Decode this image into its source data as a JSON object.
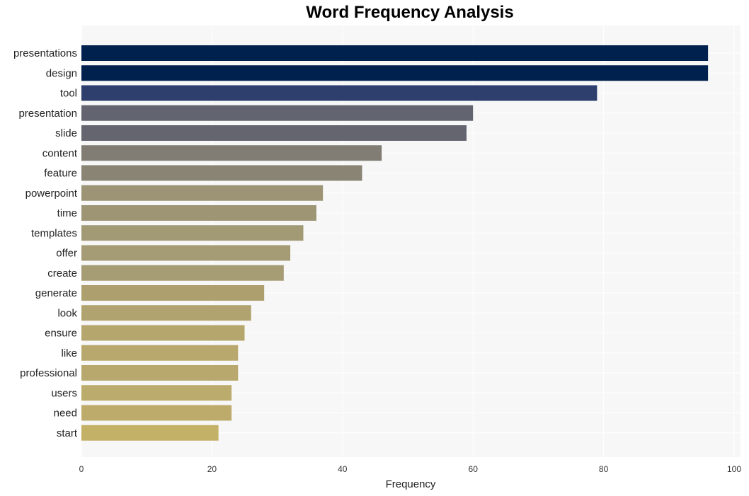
{
  "chart_data": {
    "type": "bar",
    "orientation": "horizontal",
    "title": "Word Frequency Analysis",
    "xlabel": "Frequency",
    "ylabel": "",
    "xlim": [
      0,
      100
    ],
    "xticks": [
      0,
      20,
      40,
      60,
      80,
      100
    ],
    "grid": true,
    "categories": [
      "presentations",
      "design",
      "tool",
      "presentation",
      "slide",
      "content",
      "feature",
      "powerpoint",
      "time",
      "templates",
      "offer",
      "create",
      "generate",
      "look",
      "ensure",
      "like",
      "professional",
      "users",
      "need",
      "start"
    ],
    "values": [
      96,
      96,
      79,
      60,
      59,
      46,
      43,
      37,
      36,
      34,
      32,
      31,
      28,
      26,
      25,
      24,
      24,
      23,
      23,
      21
    ],
    "colors": [
      "#00214e",
      "#00214e",
      "#2e3f6e",
      "#626570",
      "#64656f",
      "#817d74",
      "#898473",
      "#9c9474",
      "#9d9574",
      "#a29975",
      "#a59b74",
      "#a79d74",
      "#ae9f6f",
      "#b1a36f",
      "#b5a66e",
      "#b8a86e",
      "#b8a86e",
      "#bbab6c",
      "#bdab6b",
      "#c4b168"
    ]
  }
}
